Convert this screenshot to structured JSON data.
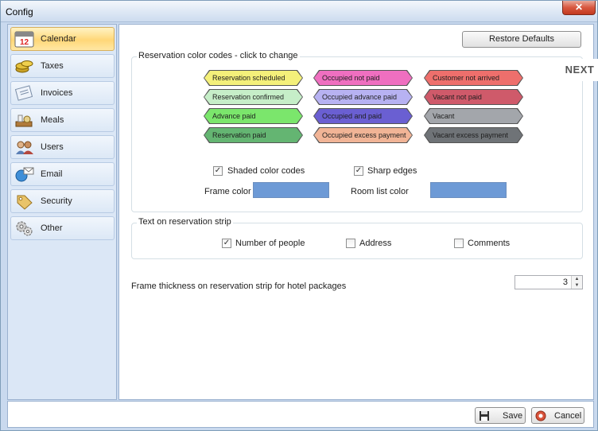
{
  "window": {
    "title": "Config",
    "close_label": "✕"
  },
  "sidebar": {
    "items": [
      {
        "label": "Calendar",
        "icon": "calendar-icon",
        "active": true
      },
      {
        "label": "Taxes",
        "icon": "coins-icon",
        "active": false
      },
      {
        "label": "Invoices",
        "icon": "invoice-icon",
        "active": false
      },
      {
        "label": "Meals",
        "icon": "meals-icon",
        "active": false
      },
      {
        "label": "Users",
        "icon": "users-icon",
        "active": false
      },
      {
        "label": "Email",
        "icon": "email-icon",
        "active": false
      },
      {
        "label": "Security",
        "icon": "security-icon",
        "active": false
      },
      {
        "label": "Other",
        "icon": "other-icon",
        "active": false
      }
    ],
    "calendar_icon_number": "12"
  },
  "main": {
    "restore_defaults_label": "Restore Defaults",
    "color_codes": {
      "title": "Reservation color codes - click to change",
      "chips": [
        {
          "label": "Reservation scheduled",
          "color": "#f4f07a"
        },
        {
          "label": "Occupied not paid",
          "color": "#ef6fc0"
        },
        {
          "label": "Customer not arrived",
          "color": "#ee6f6c"
        },
        {
          "label": "Reservation confirmed",
          "color": "#c6eec8"
        },
        {
          "label": "Occupied advance paid",
          "color": "#b7b2f2"
        },
        {
          "label": "Vacant not paid",
          "color": "#cf5a6a"
        },
        {
          "label": "Advance paid",
          "color": "#7be66c"
        },
        {
          "label": "Occupied and paid",
          "color": "#6a5fd2"
        },
        {
          "label": "Vacant",
          "color": "#a3a6ab"
        },
        {
          "label": "Reservation paid",
          "color": "#64b572"
        },
        {
          "label": "Occupied excess payment",
          "color": "#f1b496"
        },
        {
          "label": "Vacant excess payment",
          "color": "#6f7377"
        }
      ],
      "shaded_label": "Shaded color codes",
      "shaded_checked": true,
      "sharp_label": "Sharp edges",
      "sharp_checked": true,
      "frame_color_label": "Frame color",
      "frame_color": "#6d9ad6",
      "room_list_color_label": "Room list color",
      "room_list_color": "#6d9ad6"
    },
    "strip": {
      "title": "Text on reservation strip",
      "options": [
        {
          "label": "Number of people",
          "checked": true
        },
        {
          "label": "Address",
          "checked": false
        },
        {
          "label": "Comments",
          "checked": false
        }
      ]
    },
    "frame_thickness": {
      "label": "Frame thickness on reservation strip for hotel packages",
      "value": "3"
    }
  },
  "footer": {
    "save_label": "Save",
    "cancel_label": "Cancel"
  },
  "overlay": {
    "next_label": "NEXT"
  }
}
